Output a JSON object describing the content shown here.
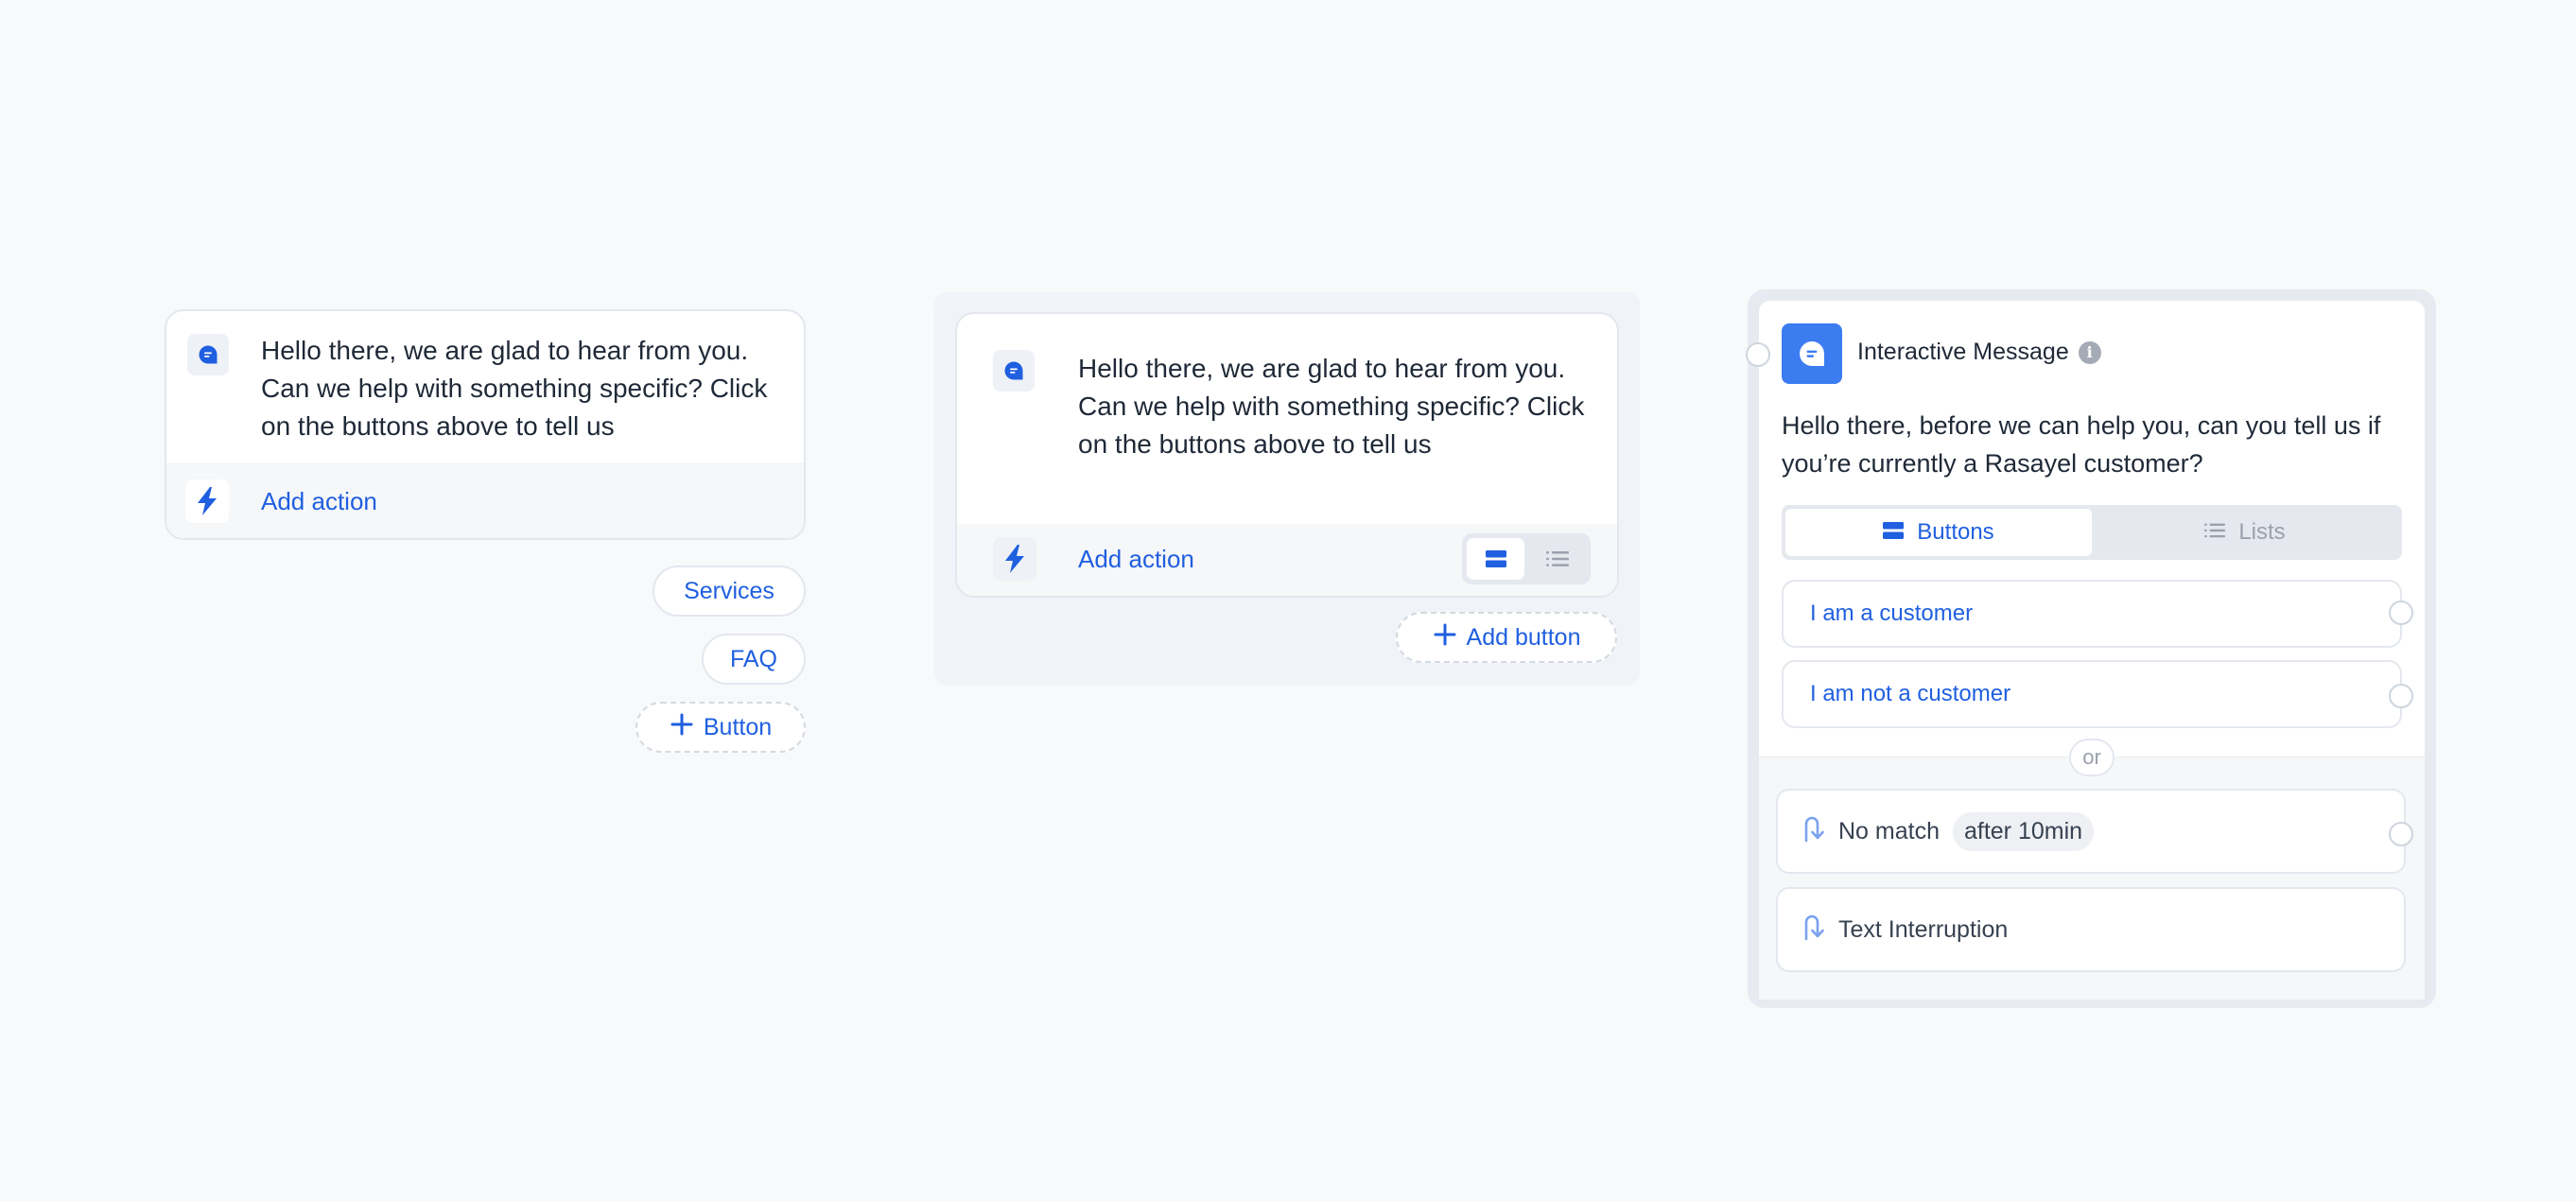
{
  "panel1": {
    "message": "Hello there, we are glad to hear from you. Can we help with something specific? Click on the buttons above to tell us",
    "action_label": "Add action",
    "buttons": [
      "Services",
      "FAQ"
    ],
    "add_button_label": "Button"
  },
  "panel2": {
    "message": "Hello there, we are glad to hear from you. Can we help with something specific? Click on the buttons above to tell us",
    "action_label": "Add action",
    "add_button_label": "Add button",
    "view_toggle": {
      "selected": "buttons",
      "options": [
        "buttons-view-icon",
        "list-view-icon"
      ]
    }
  },
  "panel3": {
    "title": "Interactive Message",
    "message": "Hello there, before we can help you, can you tell us if you’re currently a Rasayel customer?",
    "tabs": [
      {
        "label": "Buttons",
        "active": true
      },
      {
        "label": "Lists",
        "active": false
      }
    ],
    "options": [
      "I am a customer",
      "I am not a customer"
    ],
    "or_label": "or",
    "no_match": {
      "label": "No match",
      "time": "after 10min"
    },
    "text_interruption": "Text Interruption"
  },
  "colors": {
    "accent": "#1f5fe0",
    "header_icon_bg": "#3b7cf0",
    "page_bg": "#f8f9fb"
  }
}
